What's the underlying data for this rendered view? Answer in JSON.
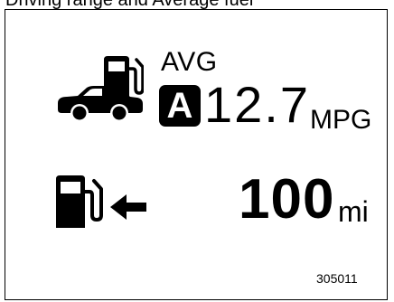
{
  "cut_text": "Driving range and Average fuel",
  "display": {
    "avg_label": "AVG",
    "mode_badge": "A",
    "fuel_economy_value": "12.7",
    "fuel_economy_unit": "MPG",
    "range_value": "100",
    "range_unit": "mi"
  },
  "figure_code": "305011",
  "icons": {
    "car": "car-icon",
    "fuel_pump_top": "fuel-pump-icon",
    "fuel_pump_bottom": "fuel-pump-icon",
    "arrow": "arrow-left-icon"
  }
}
